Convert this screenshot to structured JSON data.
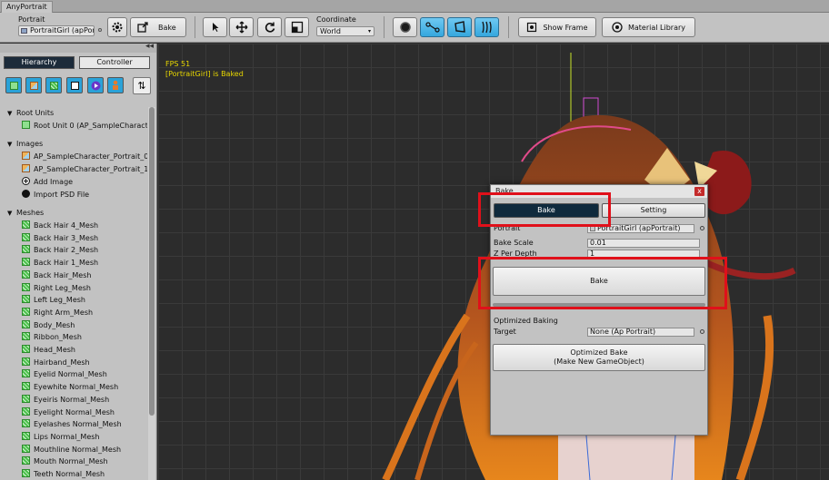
{
  "window": {
    "tab_title": "AnyPortrait"
  },
  "toolbar": {
    "portrait_label": "Portrait",
    "portrait_value": "PortraitGirl (apPor",
    "bake_label": "Bake",
    "coordinate_label": "Coordinate",
    "coordinate_value": "World",
    "show_frame_label": "Show Frame",
    "material_library_label": "Material Library"
  },
  "left_panel": {
    "tabs": [
      "Hierarchy",
      "Controller"
    ],
    "sections": {
      "root_units": {
        "title": "Root Units",
        "items": [
          "Root Unit 0 (AP_SampleCharact"
        ]
      },
      "images": {
        "title": "Images",
        "items": [
          "AP_SampleCharacter_Portrait_0",
          "AP_SampleCharacter_Portrait_1"
        ],
        "add_image": "Add Image",
        "import_psd": "Import PSD File"
      },
      "meshes": {
        "title": "Meshes",
        "items": [
          "Back Hair 4_Mesh",
          "Back Hair 3_Mesh",
          "Back Hair 2_Mesh",
          "Back Hair 1_Mesh",
          "Back Hair_Mesh",
          "Right Leg_Mesh",
          "Left Leg_Mesh",
          "Right Arm_Mesh",
          "Body_Mesh",
          "Ribbon_Mesh",
          "Head_Mesh",
          "Hairband_Mesh",
          "Eyelid Normal_Mesh",
          "Eyewhite Normal_Mesh",
          "Eyeiris Normal_Mesh",
          "Eyelight Normal_Mesh",
          "Eyelashes Normal_Mesh",
          "Lips Normal_Mesh",
          "Mouthline Normal_Mesh",
          "Mouth Normal_Mesh",
          "Teeth Normal_Mesh"
        ]
      }
    }
  },
  "viewport": {
    "fps_text": "FPS 51",
    "status_text": "[PortraitGirl] is Baked"
  },
  "bake_dialog": {
    "title": "Bake",
    "close_label": "x",
    "tab_bake": "Bake",
    "tab_setting": "Setting",
    "portrait_label": "Portrait",
    "portrait_value": "PortraitGirl (apPortrait)",
    "bake_scale_label": "Bake Scale",
    "bake_scale_value": "0.01",
    "z_per_depth_label": "Z Per Depth",
    "z_per_depth_value": "1",
    "bake_button": "Bake",
    "optimized_baking_label": "Optimized Baking",
    "target_label": "Target",
    "target_value": "None (Ap Portrait)",
    "optimized_bake_line1": "Optimized Bake",
    "optimized_bake_line2": "(Make New GameObject)"
  },
  "colors": {
    "highlight_red": "#e0101a",
    "selected_blue": "#35a7de",
    "status_yellow": "#e8d700"
  }
}
